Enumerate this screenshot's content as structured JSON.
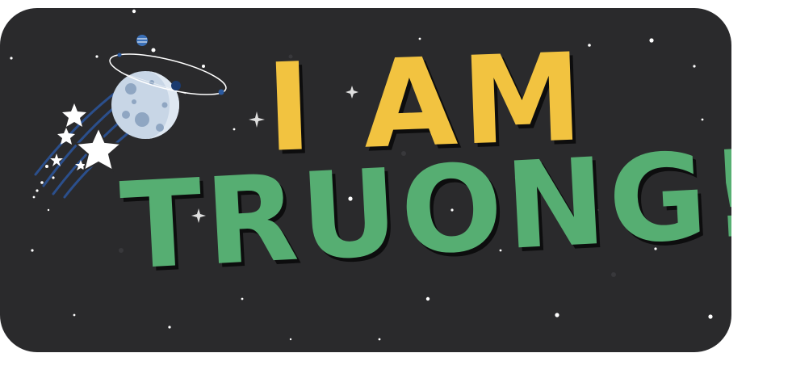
{
  "banner": {
    "background_color": "#2a2a2c",
    "logo_icon": "moon-planet-shooting-stars-icon",
    "headline": {
      "line1": "I AM",
      "line2": "TRUONG!",
      "line1_color": "#f2c340",
      "line2_color": "#56ae72"
    }
  }
}
